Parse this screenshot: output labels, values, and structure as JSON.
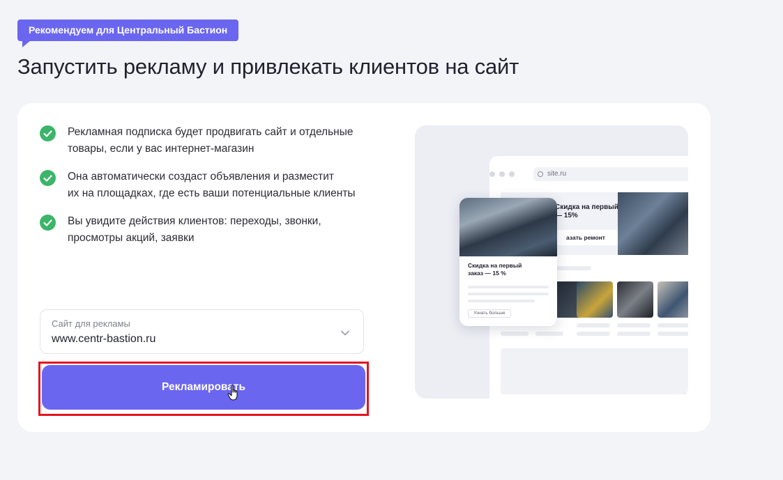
{
  "badge": {
    "label": "Рекомендуем для Центральный Бастион"
  },
  "title": "Запустить рекламу и привлекать клиентов на сайт",
  "features": [
    {
      "icon": "check-circle-icon",
      "text": "Рекламная подписка будет продвигать сайт и отдельные\nтовары, если у вас интернет-магазин"
    },
    {
      "icon": "check-circle-icon",
      "text": "Она автоматически создаст объявления и разместит\nих на площадках, где есть ваши потенциальные клиенты"
    },
    {
      "icon": "check-circle-icon",
      "text": "Вы увидите действия клиентов: переходы, звонки,\nпросмотры акций, заявки"
    }
  ],
  "site_select": {
    "label": "Сайт для рекламы",
    "value": "www.centr-bastion.ru"
  },
  "cta": {
    "label": "Рекламировать"
  },
  "illustration": {
    "url": "site.ru",
    "hero_text": "Скидка на первый\n— 15%",
    "hero_button": "азать ремонт",
    "card_text": "Скидка на первый\nзаказ — 15 %",
    "card_button": "Узнать больше"
  },
  "colors": {
    "accent": "#6b66f0",
    "check": "#3cb56a",
    "highlight": "#e3131e",
    "background": "#f3f4f8"
  }
}
